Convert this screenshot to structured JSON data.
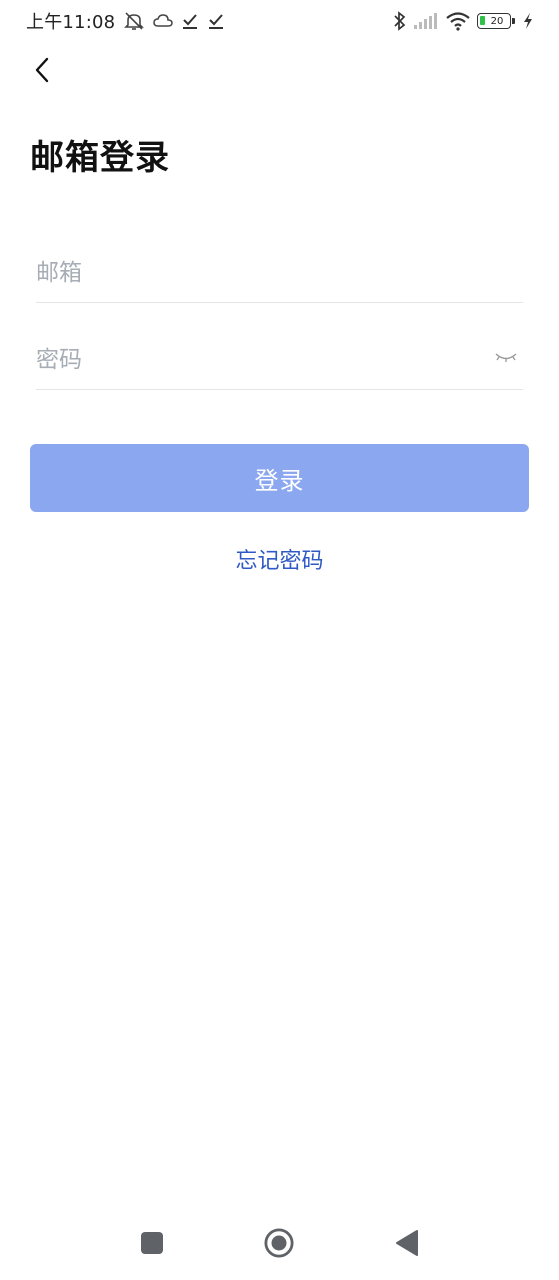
{
  "status_bar": {
    "time": "上午11:08",
    "battery_level": "20"
  },
  "header": {
    "title": "邮箱登录"
  },
  "form": {
    "email_placeholder": "邮箱",
    "email_value": "",
    "password_placeholder": "密码",
    "password_value": "",
    "login_label": "登录",
    "forgot_label": "忘记密码"
  },
  "colors": {
    "primary_button": "#8aa7f0",
    "link": "#2f59c4",
    "placeholder": "#a6adb5",
    "battery_fill": "#2ec24a"
  },
  "icons": {
    "back": "chevron-left-icon",
    "password_toggle": "eye-closed-icon",
    "nav_recent": "square-icon",
    "nav_home": "circle-icon",
    "nav_back": "triangle-left-icon"
  }
}
